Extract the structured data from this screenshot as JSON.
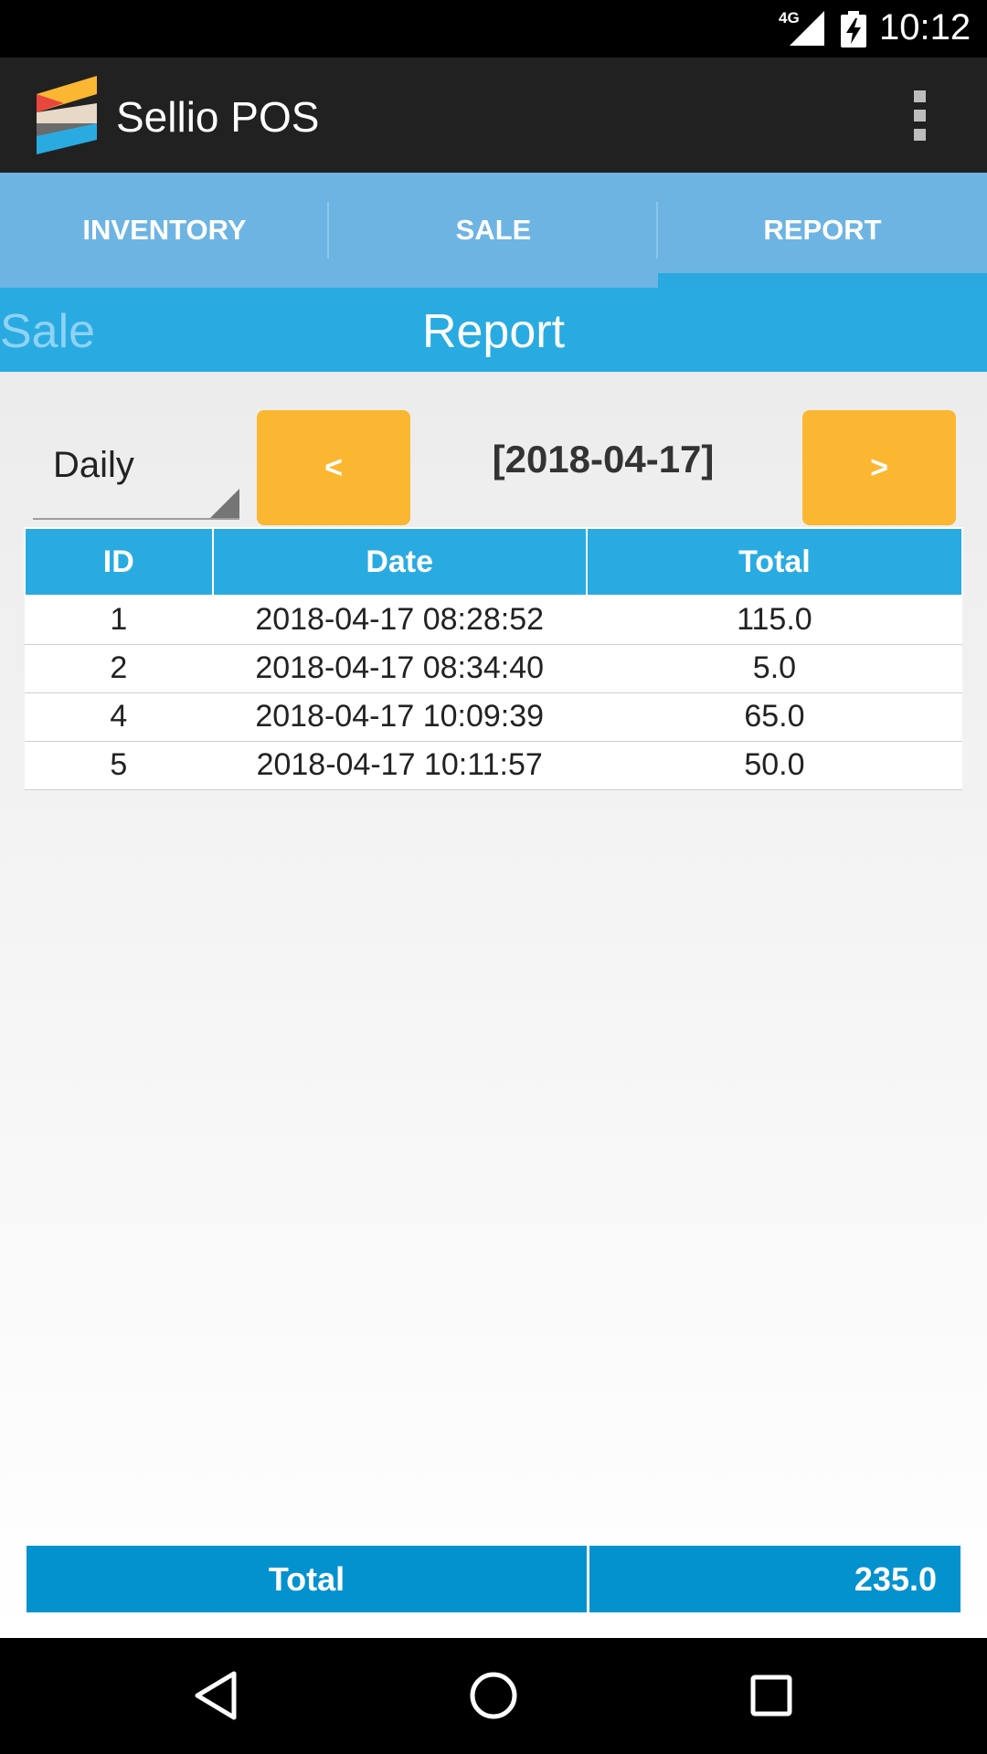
{
  "status_bar": {
    "network": "4G",
    "time": "10:12"
  },
  "app_bar": {
    "title": "Sellio POS",
    "logo_icon": "sellio-logo-icon",
    "menu_icon": "overflow-menu-icon"
  },
  "tabs": [
    {
      "label": "INVENTORY",
      "active": false
    },
    {
      "label": "SALE",
      "active": false
    },
    {
      "label": "REPORT",
      "active": true
    }
  ],
  "section": {
    "left_title": "Sale",
    "center_title": "Report"
  },
  "controls": {
    "period_selected": "Daily",
    "prev_label": "<",
    "next_label": ">",
    "current_date": "[2018-04-17]"
  },
  "table": {
    "headers": [
      "ID",
      "Date",
      "Total"
    ],
    "rows": [
      {
        "id": "1",
        "date": "2018-04-17 08:28:52",
        "total": "115.0"
      },
      {
        "id": "2",
        "date": "2018-04-17 08:34:40",
        "total": "5.0"
      },
      {
        "id": "4",
        "date": "2018-04-17 10:09:39",
        "total": "65.0"
      },
      {
        "id": "5",
        "date": "2018-04-17 10:11:57",
        "total": "50.0"
      }
    ]
  },
  "summary": {
    "label": "Total",
    "value": "235.0"
  },
  "colors": {
    "tab_bar": "#6db4e3",
    "accent_blue": "#29abe2",
    "button_orange": "#fbb731",
    "total_blue": "#0492cf"
  }
}
